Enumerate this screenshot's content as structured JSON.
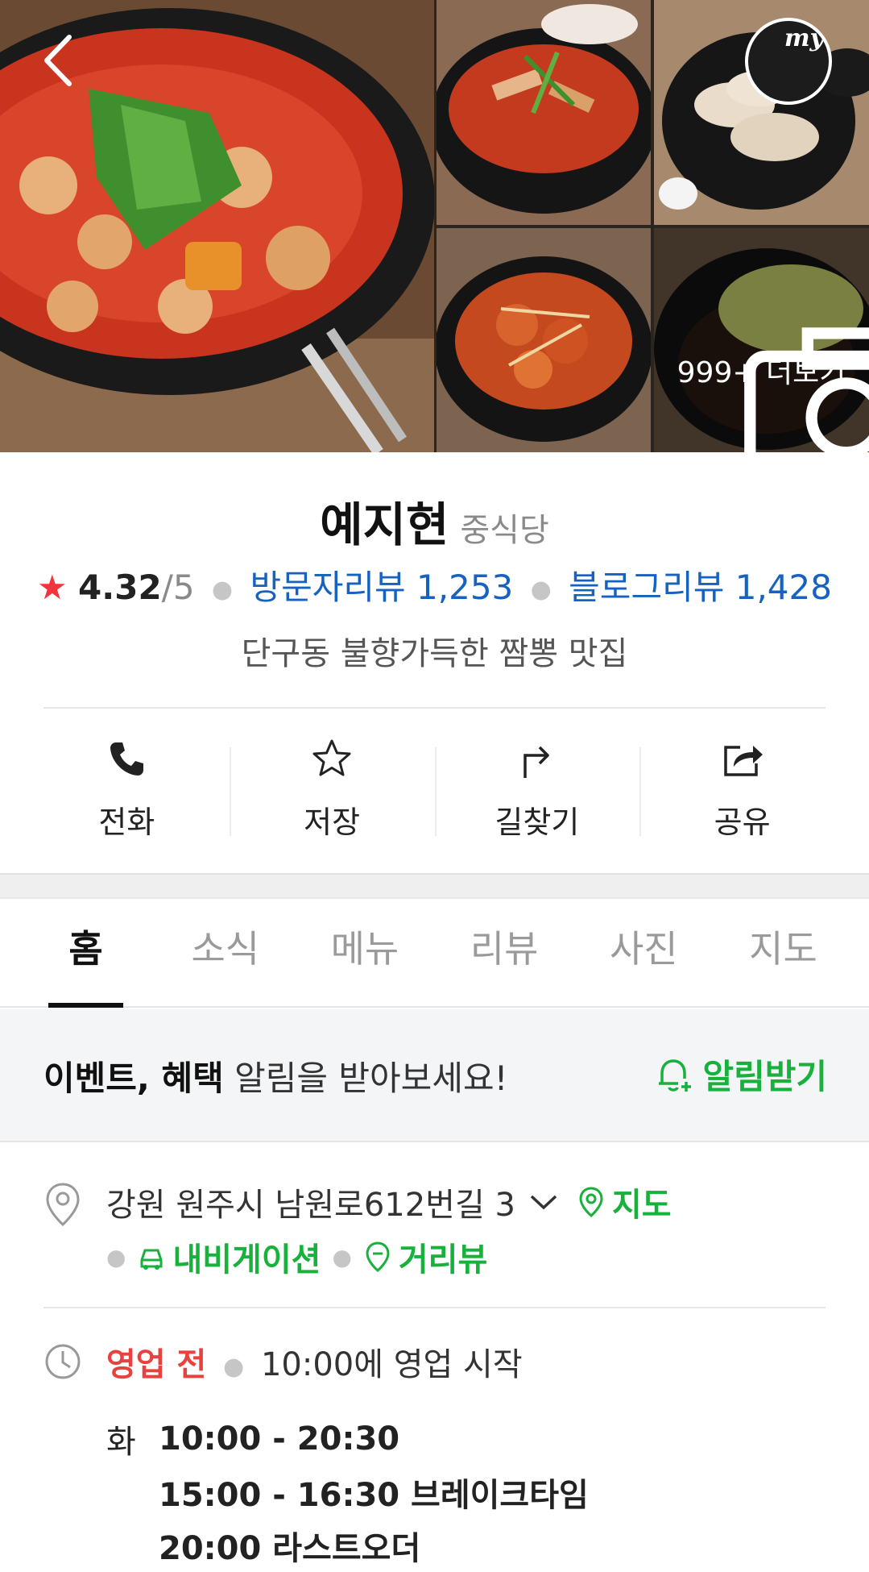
{
  "header": {
    "back_icon": "chevron-left-icon",
    "my_label": "my",
    "photo_more": "999+ 더보기"
  },
  "place": {
    "name": "예지현",
    "category": "중식당",
    "rating": "4.32",
    "rating_max": "/5",
    "visitor_reviews_label": "방문자리뷰 1,253",
    "blog_reviews_label": "블로그리뷰 1,428",
    "description": "단구동 불향가득한 짬뽕 맛집"
  },
  "actions": [
    {
      "label": "전화",
      "icon": "phone-icon"
    },
    {
      "label": "저장",
      "icon": "star-outline-icon"
    },
    {
      "label": "길찾기",
      "icon": "directions-icon"
    },
    {
      "label": "공유",
      "icon": "share-icon"
    }
  ],
  "tabs": [
    {
      "label": "홈",
      "active": true
    },
    {
      "label": "소식"
    },
    {
      "label": "메뉴"
    },
    {
      "label": "리뷰"
    },
    {
      "label": "사진"
    },
    {
      "label": "지도"
    }
  ],
  "notice": {
    "bold_text": "이벤트, 혜택",
    "text": " 알림을 받아보세요!",
    "button_label": "알림받기"
  },
  "address": {
    "text": "강원 원주시 남원로612번길 3",
    "map_label": "지도",
    "navigation_label": "내비게이션",
    "streetview_label": "거리뷰"
  },
  "hours": {
    "status": "영업 전",
    "status_detail": "10:00에 영업 시작",
    "day": "화",
    "open": "10:00 - 20:30",
    "break": "15:00 - 16:30 브레이크타임",
    "last_order": "20:00 라스트오더"
  },
  "colors": {
    "accent_green": "#17b13c",
    "link_blue": "#1562c0",
    "status_red": "#e8423f",
    "star_red": "#f0363c"
  }
}
